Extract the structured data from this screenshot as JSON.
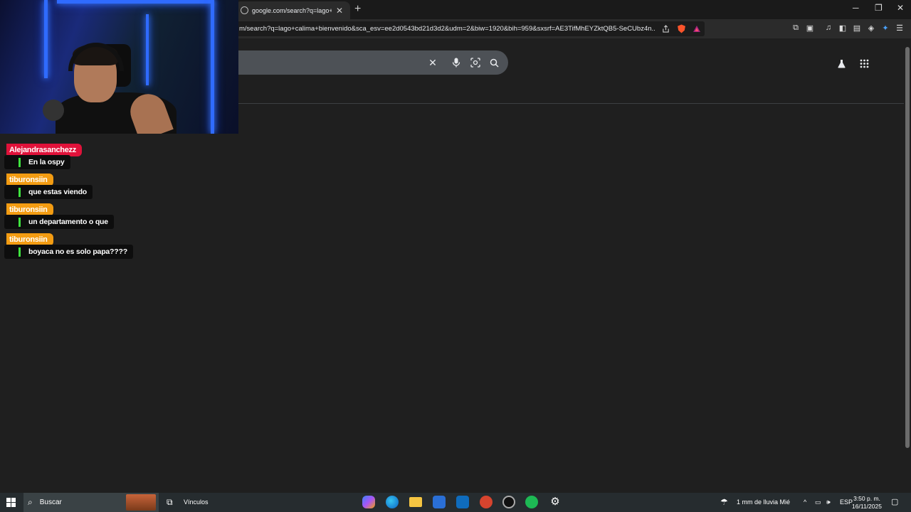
{
  "browser": {
    "tab_title": "google.com/search?q=lago+cali",
    "url": "m/search?q=lago+calima+bienvenido&sca_esv=ee2d0543bd21d3d2&udm=2&biw=1920&bih=959&sxsrf=AE3TifMhEYZktQB5-SeCUbz4n...",
    "tab_close": "✕",
    "new_tab": "+",
    "window_controls": [
      "─",
      "❐",
      "✕"
    ]
  },
  "search": {
    "clear_icon": "✕",
    "icons": [
      "clear-icon",
      "mic-icon",
      "lens-icon",
      "search-icon"
    ]
  },
  "chat": {
    "messages": [
      {
        "user": "Alejandrasanchezz",
        "text": "En la ospy",
        "color": "#e0123a"
      },
      {
        "user": "tiburonsiin",
        "text": "que estas viendo",
        "color": "#f39c12"
      },
      {
        "user": "tiburonsiin",
        "text": "un departamento o que",
        "color": "#f39c12"
      },
      {
        "user": "tiburonsiin",
        "text": "boyaca no es solo papa????",
        "color": "#f39c12"
      }
    ]
  },
  "taskbar": {
    "search_label": "Buscar",
    "links_label": "Vínculos",
    "weather": "1 mm de lluvia Mié",
    "language": "ESP",
    "time": "3:50 p. m.",
    "date": "16/11/2025"
  },
  "colors": {
    "page_bg": "#1f1f1f",
    "accent_green": "#3ee23e",
    "led_blue": "#2f6bff"
  }
}
